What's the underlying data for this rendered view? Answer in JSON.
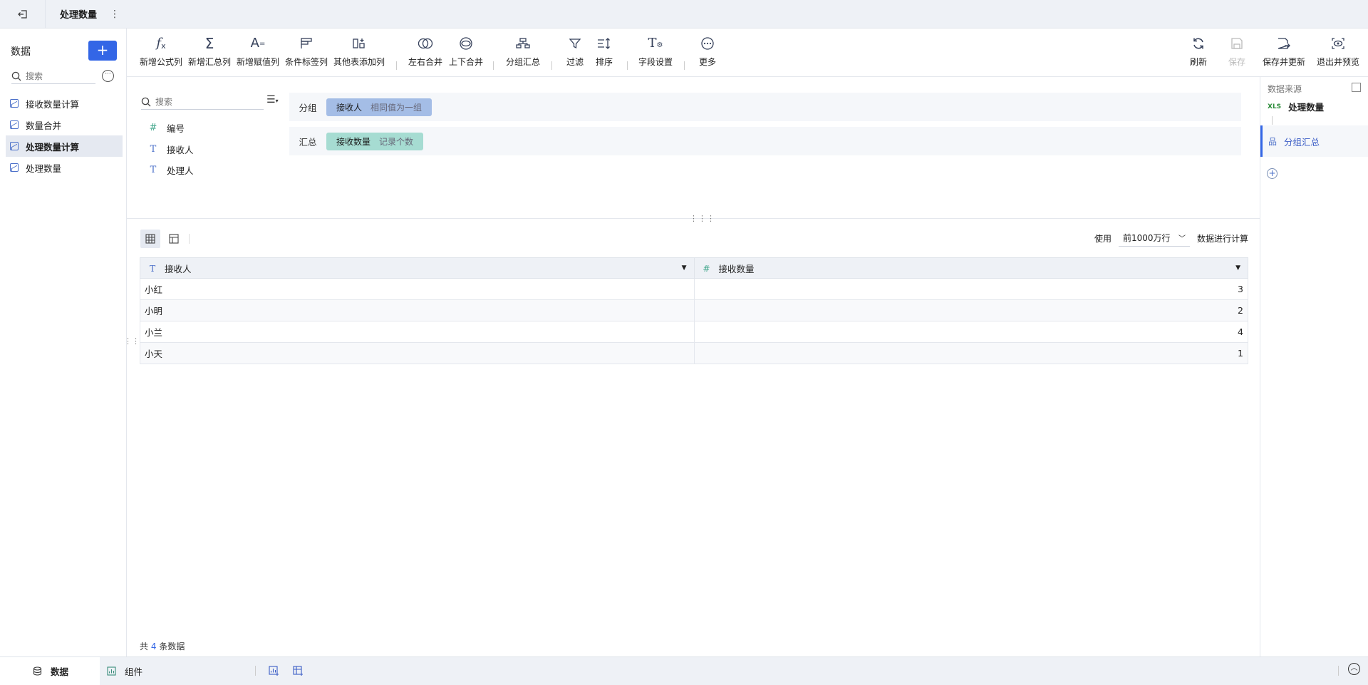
{
  "topbar": {
    "title": "处理数量"
  },
  "sidebar": {
    "header": "数据",
    "add_label": "+",
    "search_placeholder": "搜索",
    "items": [
      {
        "label": "接收数量计算"
      },
      {
        "label": "数量合并"
      },
      {
        "label": "处理数量计算"
      },
      {
        "label": "处理数量"
      }
    ],
    "active_index": 2
  },
  "toolbar": {
    "buttons": [
      {
        "id": "formula",
        "label": "新增公式列",
        "icon": "fx-icon"
      },
      {
        "id": "summary",
        "label": "新增汇总列",
        "icon": "sigma-icon"
      },
      {
        "id": "assign",
        "label": "新增赋值列",
        "icon": "assign-value-icon"
      },
      {
        "id": "cond",
        "label": "条件标签列",
        "icon": "condition-tag-icon"
      },
      {
        "id": "other",
        "label": "其他表添加列",
        "icon": "add-column-icon"
      },
      {
        "id": "lrmerge",
        "label": "左右合并",
        "icon": "left-right-merge-icon"
      },
      {
        "id": "udmerge",
        "label": "上下合并",
        "icon": "up-down-merge-icon"
      },
      {
        "id": "group",
        "label": "分组汇总",
        "icon": "group-summary-icon"
      },
      {
        "id": "filter",
        "label": "过滤",
        "icon": "filter-icon"
      },
      {
        "id": "sort",
        "label": "排序",
        "icon": "sort-icon"
      },
      {
        "id": "fieldset",
        "label": "字段设置",
        "icon": "field-settings-icon"
      },
      {
        "id": "more",
        "label": "更多",
        "icon": "more-icon"
      }
    ],
    "right_buttons": [
      {
        "id": "refresh",
        "label": "刷新",
        "icon": "refresh-icon"
      },
      {
        "id": "save",
        "label": "保存",
        "icon": "save-icon",
        "disabled": true
      },
      {
        "id": "saveupdate",
        "label": "保存并更新",
        "icon": "save-update-icon"
      },
      {
        "id": "exit",
        "label": "退出并预览",
        "icon": "exit-preview-icon"
      }
    ]
  },
  "fields": {
    "search_placeholder": "搜索",
    "items": [
      {
        "type": "#",
        "label": "编号"
      },
      {
        "type": "T",
        "label": "接收人"
      },
      {
        "type": "T",
        "label": "处理人"
      }
    ]
  },
  "config": {
    "group_label": "分组",
    "group_pill": {
      "field": "接收人",
      "mode": "相同值为一组"
    },
    "summary_label": "汇总",
    "summary_pill": {
      "field": "接收数量",
      "mode": "记录个数"
    }
  },
  "limit": {
    "prefix": "使用",
    "value": "前1000万行",
    "suffix": "数据进行计算"
  },
  "table": {
    "columns": [
      {
        "type": "T",
        "name": "接收人"
      },
      {
        "type": "#",
        "name": "接收数量"
      }
    ],
    "rows": [
      [
        "小红",
        "3"
      ],
      [
        "小明",
        "2"
      ],
      [
        "小兰",
        "4"
      ],
      [
        "小天",
        "1"
      ]
    ]
  },
  "footer": {
    "prefix": "共",
    "count": "4",
    "suffix": "条数据"
  },
  "rightpanel": {
    "title": "数据来源",
    "source_badge": "XLS",
    "source": "处理数量",
    "step": "分组汇总"
  },
  "bottombar": {
    "tab_data": "数据",
    "tab_component": "组件"
  },
  "colors": {
    "accent": "#3366e6",
    "group_pill": "#a4bde6",
    "summary_pill": "#a6dcd2"
  }
}
